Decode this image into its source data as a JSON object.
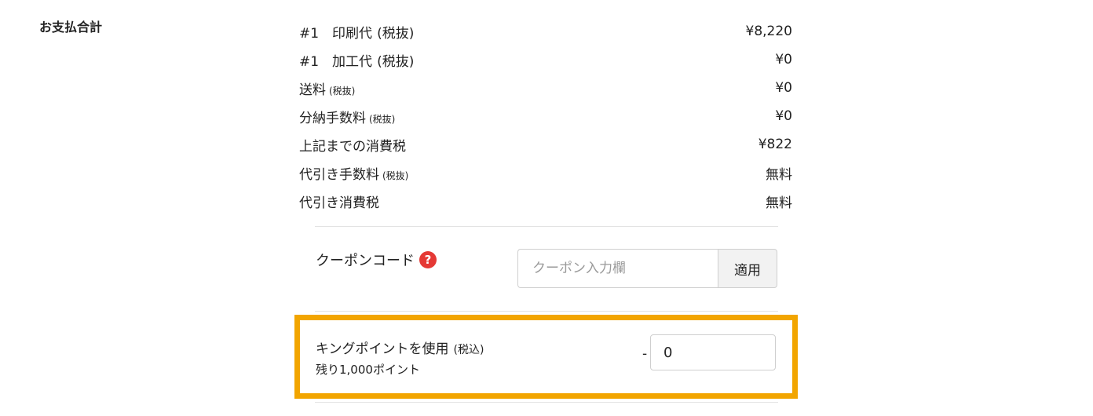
{
  "section_title": "お支払合計",
  "rows": [
    {
      "label": "#1　印刷代",
      "note": "(税抜)",
      "value": "¥8,220"
    },
    {
      "label": "#1　加工代",
      "note": "(税抜)",
      "value": "¥0"
    },
    {
      "label": "送料",
      "note": "(税抜)",
      "value": "¥0"
    },
    {
      "label": "分納手数料",
      "note": "(税抜)",
      "value": "¥0"
    },
    {
      "label": "上記までの消費税",
      "note": "",
      "value": "¥822"
    },
    {
      "label": "代引き手数料",
      "note": "(税抜)",
      "value": "無料"
    },
    {
      "label": "代引き消費税",
      "note": "",
      "value": "無料"
    }
  ],
  "coupon": {
    "label": "クーポンコード",
    "help_icon": "question-circle-icon",
    "help_glyph": "?",
    "placeholder": "クーポン入力欄",
    "value": "",
    "apply_label": "適用"
  },
  "points": {
    "title": "キングポイントを使用",
    "title_note": "(税込)",
    "remaining": "残り1,000ポイント",
    "minus": "-",
    "value": "0",
    "highlight_color": "#f2a500"
  }
}
